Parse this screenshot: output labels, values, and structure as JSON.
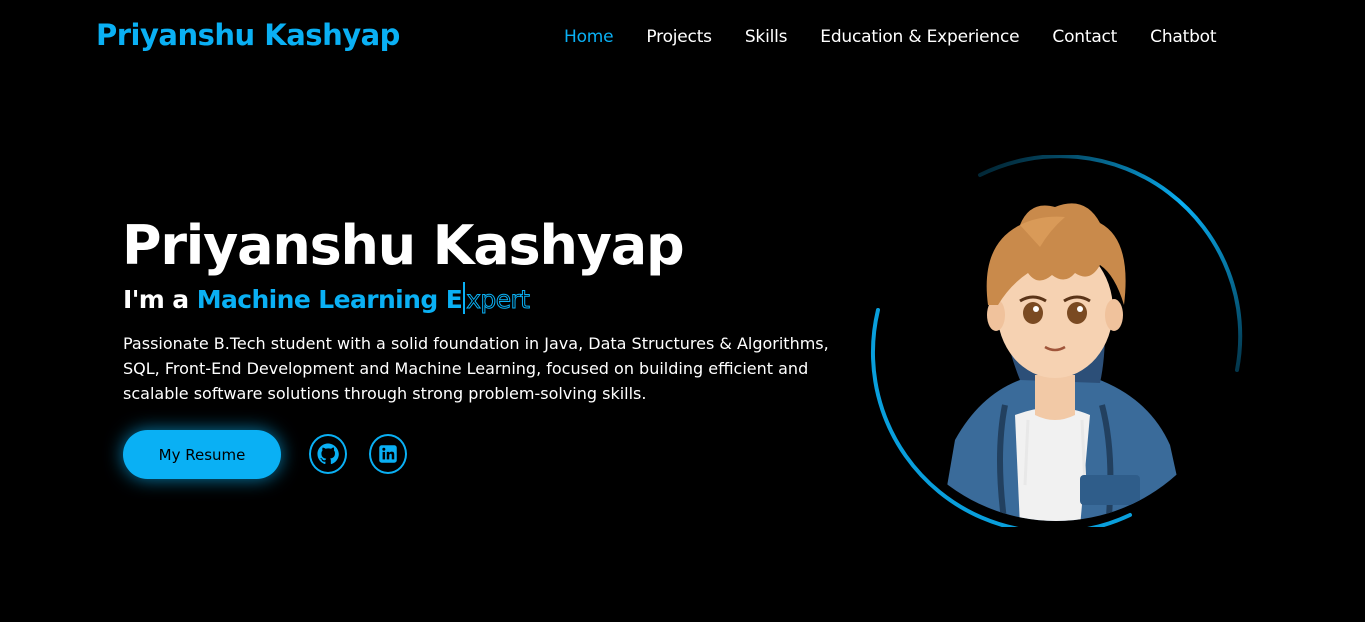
{
  "header": {
    "logo": "Priyanshu Kashyap",
    "nav": [
      "Home",
      "Projects",
      "Skills",
      "Education & Experience",
      "Contact",
      "Chatbot"
    ],
    "active_nav": "Home"
  },
  "hero": {
    "name": "Priyanshu Kashyap",
    "role_prefix": "I'm a",
    "role_typed": "Machine Learning E",
    "role_remaining": "xpert",
    "description": "Passionate B.Tech student with a solid foundation in Java, Data Structures & Algorithms, SQL, Front-End Development and Machine Learning, focused on building efficient and scalable software solutions through strong problem-solving skills.",
    "resume_label": "My Resume",
    "socials": [
      {
        "name": "github",
        "icon": "github-icon"
      },
      {
        "name": "linkedin",
        "icon": "linkedin-icon"
      }
    ]
  },
  "colors": {
    "accent": "#0ab0f4",
    "background": "#000000",
    "text": "#ffffff"
  }
}
